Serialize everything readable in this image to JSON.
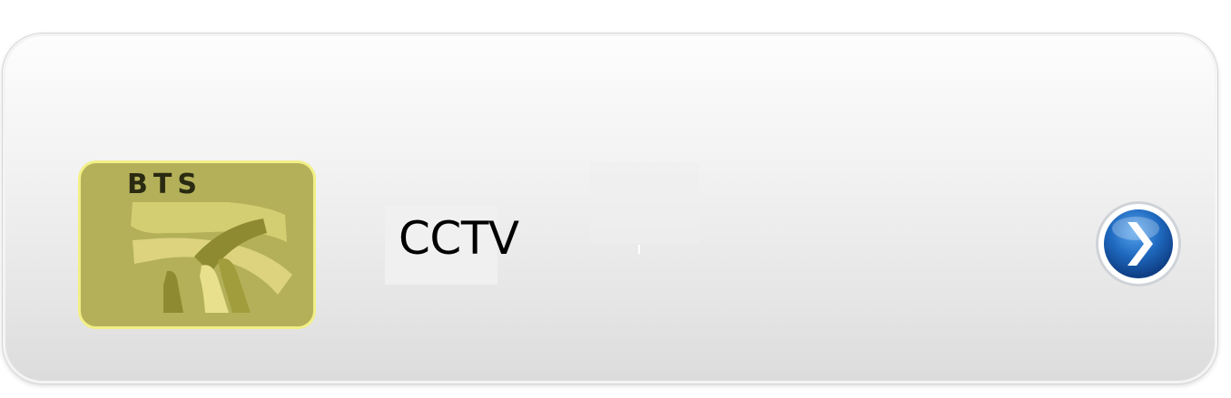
{
  "item": {
    "logo_text": "BTS",
    "label": "CCTV",
    "next_icon": "chevron-right-circle-icon"
  },
  "colors": {
    "logo_background": "#b4b05a",
    "logo_border": "#f2ef86",
    "logo_stripes_light": "#e8e08c",
    "logo_stripes_dark": "#8d8a31",
    "arrow_blue": "#1f6ac0"
  }
}
